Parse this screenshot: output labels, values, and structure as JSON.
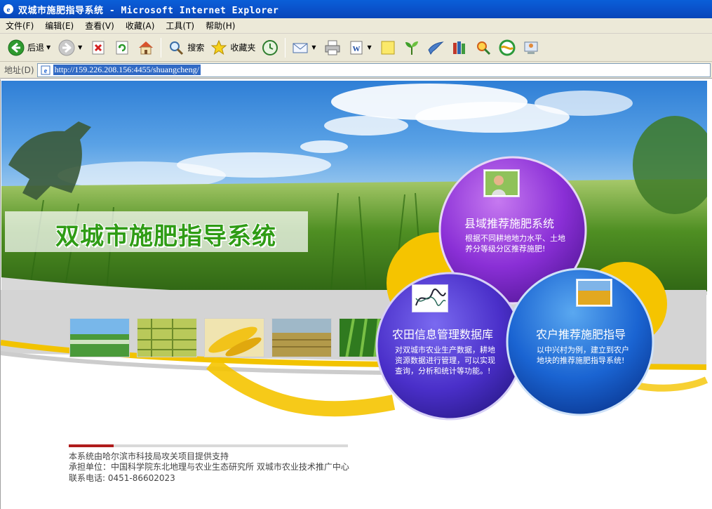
{
  "window": {
    "title": "双城市施肥指导系统 - Microsoft Internet Explorer"
  },
  "menu": {
    "items": [
      "文件(F)",
      "编辑(E)",
      "查看(V)",
      "收藏(A)",
      "工具(T)",
      "帮助(H)"
    ]
  },
  "toolbar": {
    "back_label": "后退",
    "search_label": "搜索",
    "favorites_label": "收藏夹"
  },
  "address": {
    "label": "地址(D)",
    "url": "http://159.226.208.156:4455/shuangcheng/"
  },
  "page": {
    "site_title": "双城市施肥指导系统",
    "circles": [
      {
        "title": "县域推荐施肥系统",
        "desc_lines": [
          "根据不同耕地地力水平、土地",
          "养分等级分区推荐施肥!"
        ]
      },
      {
        "title": "农田信息管理数据库",
        "desc_lines": [
          "对双城市农业生产数据，耕地",
          "资源数据进行管理，可以实现",
          "查询，分析和统计等功能。!"
        ]
      },
      {
        "title": "农户推荐施肥指导",
        "desc_lines": [
          "以中兴村为例，建立到农户",
          "地块的推荐施肥指导系统!"
        ]
      }
    ],
    "footer": {
      "support": "本系统由哈尔滨市科技局攻关项目提供支持",
      "organizer": "承担单位：中国科学院东北地理与农业生态研究所    双城市农业技术推广中心",
      "phone": "联系电话: 0451-86602023"
    }
  },
  "colors": {
    "titlebar": "#0a53cc",
    "title_green": "#2f9c15",
    "circle_purple": "#8a2fd6",
    "circle_indigo": "#4a2fc9",
    "circle_blue": "#1a64d2",
    "accent_yellow": "#f5c400"
  }
}
